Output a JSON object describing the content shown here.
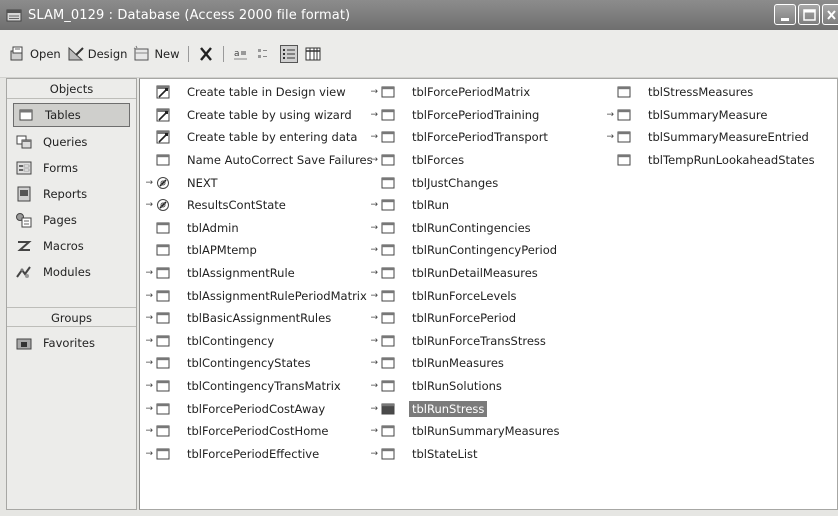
{
  "window": {
    "title": "SLAM_0129 : Database (Access 2000 file format)"
  },
  "toolbar": {
    "open_label": "Open",
    "design_label": "Design",
    "new_label": "New",
    "delete_icon": "delete-x-icon",
    "view_icons": [
      "large-icons-icon",
      "small-icons-icon",
      "list-icon",
      "details-icon"
    ]
  },
  "sidebar": {
    "objects_label": "Objects",
    "items": [
      {
        "label": "Tables",
        "icon": "table-icon"
      },
      {
        "label": "Queries",
        "icon": "query-icon"
      },
      {
        "label": "Forms",
        "icon": "form-icon"
      },
      {
        "label": "Reports",
        "icon": "report-icon"
      },
      {
        "label": "Pages",
        "icon": "page-icon"
      },
      {
        "label": "Macros",
        "icon": "macro-icon"
      },
      {
        "label": "Modules",
        "icon": "module-icon"
      }
    ],
    "groups_label": "Groups",
    "favorites_label": "Favorites"
  },
  "list": {
    "selected": "tblRunStress",
    "columns": [
      [
        {
          "label": "Create table in Design view",
          "kind": "wizard",
          "linked": false
        },
        {
          "label": "Create table by using wizard",
          "kind": "wizard",
          "linked": false
        },
        {
          "label": "Create table by entering data",
          "kind": "wizard",
          "linked": false
        },
        {
          "label": "Name AutoCorrect Save Failures",
          "kind": "table",
          "linked": false
        },
        {
          "label": "NEXT",
          "kind": "linked-query",
          "linked": true
        },
        {
          "label": "ResultsContState",
          "kind": "linked-query",
          "linked": true
        },
        {
          "label": "tblAdmin",
          "kind": "table",
          "linked": false
        },
        {
          "label": "tblAPMtemp",
          "kind": "table",
          "linked": false
        },
        {
          "label": "tblAssignmentRule",
          "kind": "table",
          "linked": true
        },
        {
          "label": "tblAssignmentRulePeriodMatrix",
          "kind": "table",
          "linked": true
        },
        {
          "label": "tblBasicAssignmentRules",
          "kind": "table",
          "linked": true
        },
        {
          "label": "tblContingency",
          "kind": "table",
          "linked": true
        },
        {
          "label": "tblContingencyStates",
          "kind": "table",
          "linked": true
        },
        {
          "label": "tblContingencyTransMatrix",
          "kind": "table",
          "linked": true
        },
        {
          "label": "tblForcePeriodCostAway",
          "kind": "table",
          "linked": true
        },
        {
          "label": "tblForcePeriodCostHome",
          "kind": "table",
          "linked": true
        },
        {
          "label": "tblForcePeriodEffective",
          "kind": "table",
          "linked": true
        }
      ],
      [
        {
          "label": "tblForcePeriodMatrix",
          "kind": "table",
          "linked": true
        },
        {
          "label": "tblForcePeriodTraining",
          "kind": "table",
          "linked": true
        },
        {
          "label": "tblForcePeriodTransport",
          "kind": "table",
          "linked": true
        },
        {
          "label": "tblForces",
          "kind": "table",
          "linked": true
        },
        {
          "label": "tblJustChanges",
          "kind": "table",
          "linked": false
        },
        {
          "label": "tblRun",
          "kind": "table",
          "linked": true
        },
        {
          "label": "tblRunContingencies",
          "kind": "table",
          "linked": true
        },
        {
          "label": "tblRunContingencyPeriod",
          "kind": "table",
          "linked": true
        },
        {
          "label": "tblRunDetailMeasures",
          "kind": "table",
          "linked": true
        },
        {
          "label": "tblRunForceLevels",
          "kind": "table",
          "linked": true
        },
        {
          "label": "tblRunForcePeriod",
          "kind": "table",
          "linked": true
        },
        {
          "label": "tblRunForceTransStress",
          "kind": "table",
          "linked": true
        },
        {
          "label": "tblRunMeasures",
          "kind": "table",
          "linked": true
        },
        {
          "label": "tblRunSolutions",
          "kind": "table",
          "linked": true
        },
        {
          "label": "tblRunStress",
          "kind": "table",
          "linked": true
        },
        {
          "label": "tblRunSummaryMeasures",
          "kind": "table",
          "linked": true
        },
        {
          "label": "tblStateList",
          "kind": "table",
          "linked": true
        }
      ],
      [
        {
          "label": "tblStressMeasures",
          "kind": "table",
          "linked": false
        },
        {
          "label": "tblSummaryMeasure",
          "kind": "table",
          "linked": true
        },
        {
          "label": "tblSummaryMeasureEntried",
          "kind": "table",
          "linked": true
        },
        {
          "label": "tblTempRunLookaheadStates",
          "kind": "table",
          "linked": false
        }
      ]
    ]
  }
}
